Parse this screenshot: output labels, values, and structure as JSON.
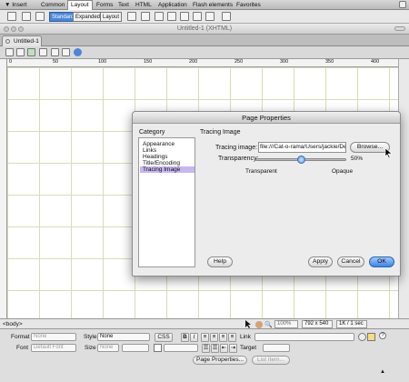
{
  "insert_bar": {
    "menu_label": "▼ Insert",
    "tabs": [
      "Common",
      "Layout",
      "Forms",
      "Text",
      "HTML",
      "Application",
      "Flash elements",
      "Favorites"
    ],
    "active_tab": "Layout",
    "view_modes": [
      "Standard",
      "Expanded",
      "Layout"
    ],
    "active_view_mode": "Standard"
  },
  "document": {
    "window_title": "Untitled-1 (XHTML)",
    "tab_label": "Untitled-1",
    "ruler_ticks": [
      "0",
      "50",
      "100",
      "150",
      "200",
      "250",
      "300",
      "350",
      "400"
    ]
  },
  "status_bar": {
    "tag": "<body>",
    "zoom": "100%",
    "window_size": "792 x 540",
    "download": "1K / 1 sec"
  },
  "properties": {
    "format_label": "Format",
    "format_value": "None",
    "style_label": "Style",
    "style_value": "None",
    "css_button": "CSS",
    "bold": "B",
    "italic": "I",
    "link_label": "Link",
    "font_label": "Font",
    "font_value": "Default Font",
    "size_label": "Size",
    "size_value": "None",
    "target_label": "Target",
    "page_properties_button": "Page Properties...",
    "list_item_button": "List Item..."
  },
  "dialog": {
    "title": "Page Properties",
    "category_header": "Category",
    "categories": [
      "Appearance",
      "Links",
      "Headings",
      "Title/Encoding",
      "Tracing Image"
    ],
    "selected_category": "Tracing Image",
    "section_header": "Tracing Image",
    "tracing_image_label": "Tracing image:",
    "tracing_image_value": "file:///Cat-o-rama/Users/jackie/De",
    "browse_button": "Browse...",
    "transparency_label": "Transparency:",
    "transparency_value": "50%",
    "transparency_fraction": 0.5,
    "transparent_label": "Transparent",
    "opaque_label": "Opaque",
    "help_button": "Help",
    "apply_button": "Apply",
    "cancel_button": "Cancel",
    "ok_button": "OK"
  },
  "colors": {
    "grid": "#d7ddb7",
    "selection": "#c8b6f0",
    "default_button": "#3d84e6"
  }
}
